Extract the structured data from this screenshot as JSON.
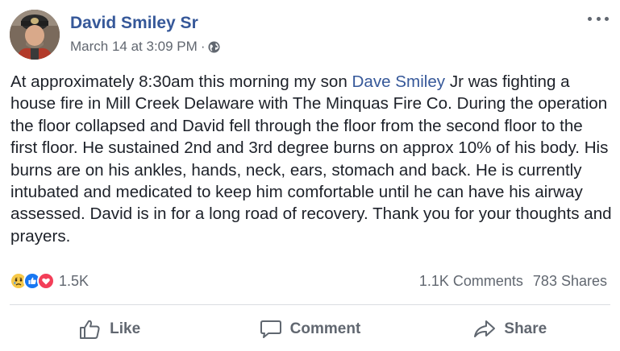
{
  "post": {
    "author": "David Smiley Sr",
    "timestamp": "March 14 at 3:09 PM",
    "separator": "·",
    "privacy_icon": "globe-icon",
    "text_before_mention": "At approximately 8:30am this morning my son ",
    "mention": "Dave Smiley",
    "text_after_mention": " Jr was fighting a house fire in Mill Creek Delaware with The Minquas Fire Co. During the operation the floor collapsed and David fell through the floor from the second floor to the first floor. He sustained 2nd and 3rd degree burns on approx 10% of his body. His burns are on his ankles, hands, neck, ears, stomach and back. He is currently intubated and medicated to keep him comfortable until he can have his airway assessed. David is in for a long road of recovery. Thank you for your thoughts and prayers."
  },
  "stats": {
    "reactions": [
      "sad-icon",
      "like-icon",
      "love-icon"
    ],
    "reaction_count": "1.5K",
    "comments": "1.1K Comments",
    "shares": "783 Shares"
  },
  "actions": {
    "like": "Like",
    "comment": "Comment",
    "share": "Share"
  },
  "colors": {
    "link": "#365899",
    "secondary": "#616770",
    "text": "#1d2129",
    "like_blue": "#1877f2",
    "love_red": "#f33e58",
    "sad_yellow": "#f7c949"
  }
}
